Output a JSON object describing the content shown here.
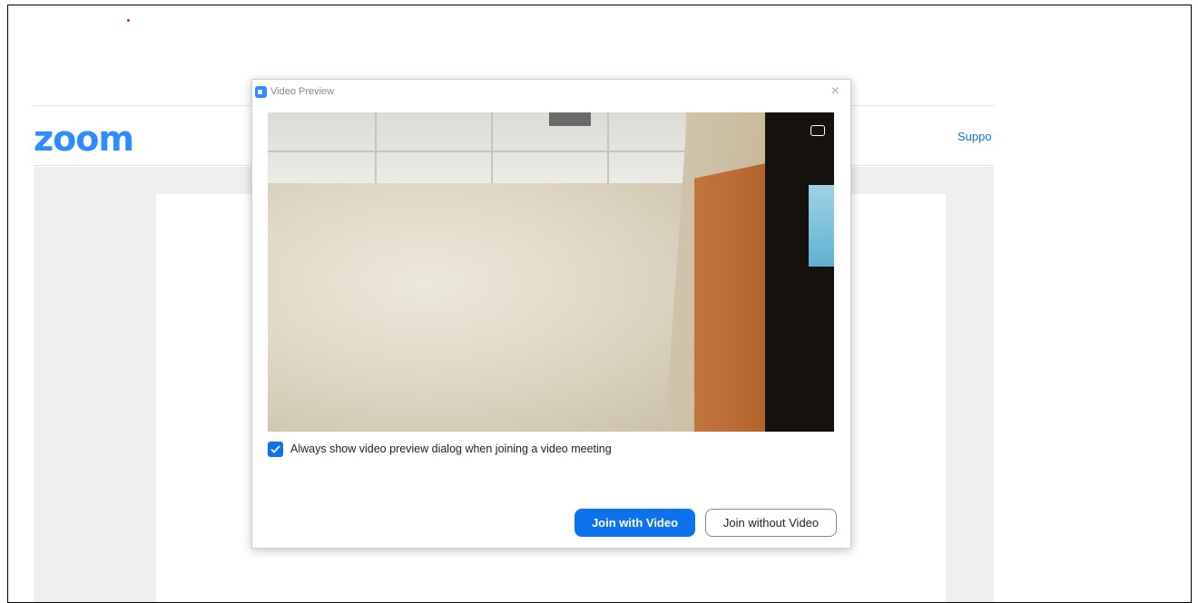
{
  "background_page": {
    "logo_text": "zoom",
    "support_link": "Suppo"
  },
  "dialog": {
    "title": "Video Preview",
    "close_icon": "close-icon",
    "camera_toggle_icon": "camera-switch-icon",
    "checkbox_label": "Always show video preview dialog when joining a video meeting",
    "checkbox_checked": true,
    "join_with_video_label": "Join with Video",
    "join_without_video_label": "Join without Video"
  },
  "colors": {
    "accent": "#0e72ed",
    "brand": "#2d8cff"
  }
}
